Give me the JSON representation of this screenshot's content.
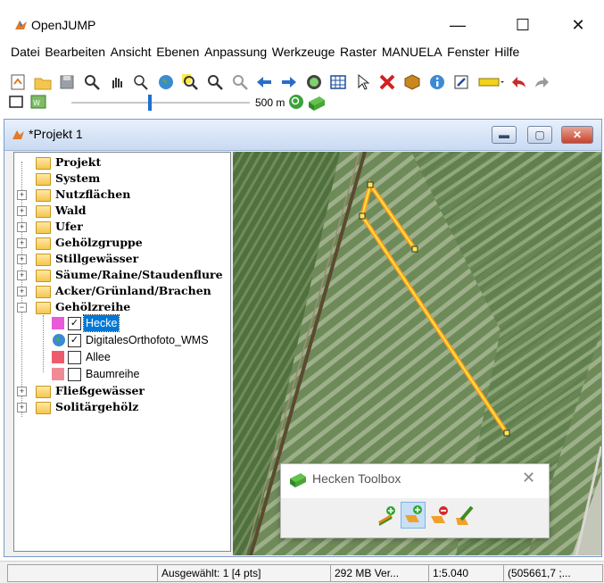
{
  "app": {
    "title": "OpenJUMP",
    "min_glyph": "—",
    "max_glyph": "☐",
    "close_glyph": "✕"
  },
  "menu": [
    "Datei",
    "Bearbeiten",
    "Ansicht",
    "Ebenen",
    "Anpassung",
    "Werkzeuge",
    "Raster",
    "MANUELA",
    "Fenster",
    "Hilfe"
  ],
  "toolbar": {
    "scale_label": "500 m"
  },
  "frame": {
    "title": "*Projekt 1",
    "min_glyph": "▬",
    "max_glyph": "▢",
    "close_glyph": "✕"
  },
  "tree": {
    "categories_top": [
      {
        "label": "Projekt",
        "expandable": false
      },
      {
        "label": "System",
        "expandable": false
      },
      {
        "label": "Nutzflächen",
        "expandable": true
      },
      {
        "label": "Wald",
        "expandable": true
      },
      {
        "label": "Ufer",
        "expandable": true
      },
      {
        "label": "Gehölzgruppe",
        "expandable": true
      },
      {
        "label": "Stillgewässer",
        "expandable": true
      },
      {
        "label": "Säume/Raine/Staudenflure",
        "expandable": true
      },
      {
        "label": "Acker/Grünland/Brachen",
        "expandable": true
      }
    ],
    "open_category": {
      "label": "Gehölzreihe",
      "toggle": "−"
    },
    "layers": [
      {
        "label": "Hecke",
        "checked": true,
        "selected": true,
        "swatch": "#e85ad8"
      },
      {
        "label": "DigitalesOrthofoto_WMS",
        "checked": true,
        "selected": false,
        "swatch": "globe"
      },
      {
        "label": "Allee",
        "checked": false,
        "selected": false,
        "swatch": "#ef5b6a"
      },
      {
        "label": "Baumreihe",
        "checked": false,
        "selected": false,
        "swatch": "#f08b95"
      }
    ],
    "categories_bottom": [
      {
        "label": "Fließgewässer",
        "expandable": true
      },
      {
        "label": "Solitärgehölz",
        "expandable": true
      }
    ],
    "plus_glyph": "+",
    "check_glyph": "✓"
  },
  "toolbox": {
    "title": "Hecken Toolbox",
    "close_glyph": "✕"
  },
  "status": {
    "selected": "Ausgewählt: 1 [4 pts]",
    "memory": "292 MB Ver...",
    "scale": "1:5.040",
    "coords": "(505661,7 ;..."
  },
  "colors": {
    "selection": "#0078d7",
    "feature_line": "#ff9f1c",
    "feature_fill": "#ffe94a"
  }
}
